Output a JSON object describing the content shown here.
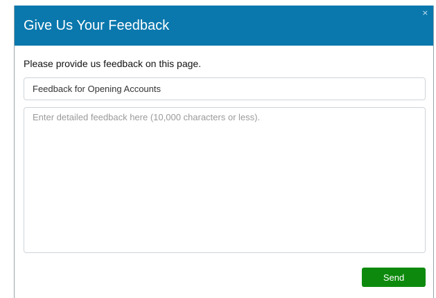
{
  "dialog": {
    "title": "Give Us Your Feedback",
    "close_glyph": "×",
    "close_icon": "close-icon",
    "prompt": "Please provide us feedback on this page.",
    "subject_value": "Feedback for Opening Accounts",
    "detail_placeholder": "Enter detailed feedback here (10,000 characters or less).",
    "send_label": "Send"
  },
  "colors": {
    "header": "#0a78ad",
    "send_button": "#0d8a0d"
  }
}
